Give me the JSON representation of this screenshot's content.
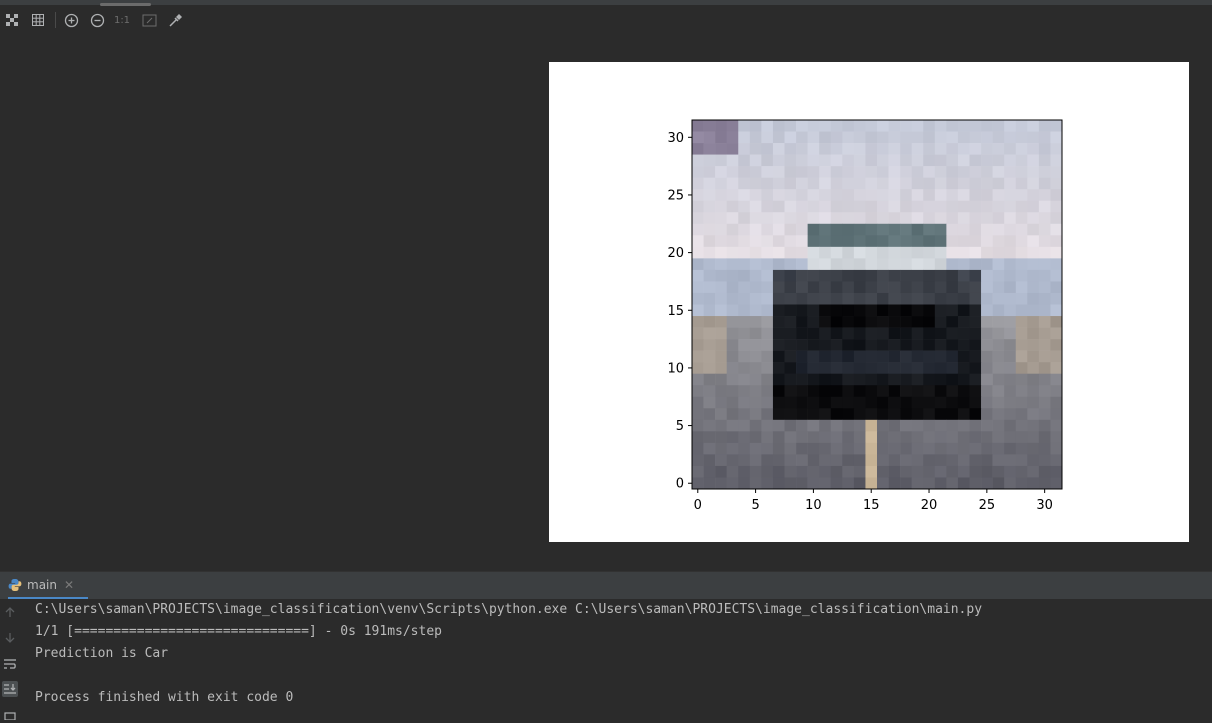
{
  "toolbar": {
    "buttons": [
      {
        "icon": "fit-to-window-icon"
      },
      {
        "icon": "grid-icon"
      },
      {
        "icon": "zoom-in-icon"
      },
      {
        "icon": "zoom-out-icon"
      },
      {
        "icon": "actual-size-icon",
        "label": "1:1"
      },
      {
        "icon": "fit-zoom-icon"
      },
      {
        "icon": "color-picker-icon"
      }
    ]
  },
  "chart_data": {
    "type": "heatmap",
    "description_free": true,
    "xticks": [
      "0",
      "5",
      "10",
      "15",
      "20",
      "25",
      "30"
    ],
    "yticks": [
      "0",
      "5",
      "10",
      "15",
      "20",
      "25",
      "30"
    ],
    "xlim": [
      -0.5,
      31.5
    ],
    "ylim": [
      31.5,
      -0.5
    ],
    "grid": false
  },
  "run_panel": {
    "tab_label": "main",
    "tab_icon": "python-icon"
  },
  "console": {
    "lines": [
      "C:\\Users\\saman\\PROJECTS\\image_classification\\venv\\Scripts\\python.exe C:\\Users\\saman\\PROJECTS\\image_classification\\main.py",
      "1/1 [==============================] - 0s 191ms/step",
      "Prediction is Car",
      "",
      "Process finished with exit code 0"
    ]
  },
  "colors": {
    "background": "#2b2b2b",
    "panel_header": "#3c3f41",
    "console_text": "#bbbbbb",
    "tab_underline": "#4a88c7"
  }
}
